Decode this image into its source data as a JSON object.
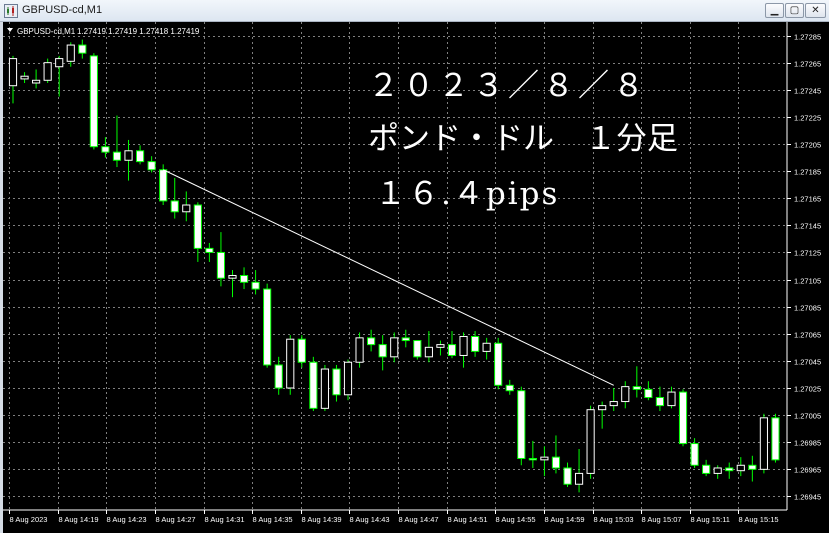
{
  "window": {
    "title": "GBPUSD-cd,M1",
    "buttons": {
      "minimize": "▁",
      "maximize": "▢",
      "close": "✕"
    }
  },
  "chart_info": {
    "symbol_label": "GBPUSD-cd,M1",
    "ohlc_label": "1.27419 1.27419 1.27418 1.27419"
  },
  "annotations": {
    "line1": "２０２３／８／８",
    "line2": "ポンド・ドル　１分足",
    "line3": "１６.４pips"
  },
  "colors": {
    "background": "#000000",
    "grid": "#7f7f7f",
    "bull_candle": "#ffffff",
    "bear_candle": "#ffffff",
    "wick": "#00ff00",
    "axis_text": "#ffffff",
    "trendline": "#ffffff"
  },
  "chart_data": {
    "type": "candlestick",
    "symbol": "GBPUSD-cd",
    "timeframe": "M1",
    "ylim": [
      1.26935,
      1.27295
    ],
    "y_ticks": [
      "1.27285",
      "1.27265",
      "1.27245",
      "1.27225",
      "1.27205",
      "1.27185",
      "1.27165",
      "1.27145",
      "1.27125",
      "1.27105",
      "1.27085",
      "1.27065",
      "1.27045",
      "1.27025",
      "1.27005",
      "1.26985",
      "1.26965",
      "1.26945"
    ],
    "x_ticks": [
      "8 Aug 2023",
      "8 Aug 14:19",
      "8 Aug 14:23",
      "8 Aug 14:27",
      "8 Aug 14:31",
      "8 Aug 14:35",
      "8 Aug 14:39",
      "8 Aug 14:43",
      "8 Aug 14:47",
      "8 Aug 14:51",
      "8 Aug 14:55",
      "8 Aug 14:59",
      "8 Aug 15:03",
      "8 Aug 15:07",
      "8 Aug 15:11",
      "8 Aug 15:15"
    ],
    "candles": [
      [
        1.27248,
        1.2727,
        1.27235,
        1.27268
      ],
      [
        1.27253,
        1.27258,
        1.2725,
        1.27255
      ],
      [
        1.2725,
        1.2726,
        1.27246,
        1.27252
      ],
      [
        1.27252,
        1.27268,
        1.2725,
        1.27265
      ],
      [
        1.27262,
        1.2727,
        1.2724,
        1.27268
      ],
      [
        1.27266,
        1.2728,
        1.27262,
        1.27278
      ],
      [
        1.27278,
        1.27282,
        1.27268,
        1.27272
      ],
      [
        1.2727,
        1.27272,
        1.27201,
        1.27203
      ],
      [
        1.27203,
        1.2721,
        1.27195,
        1.27199
      ],
      [
        1.27199,
        1.27226,
        1.27188,
        1.27193
      ],
      [
        1.27193,
        1.27208,
        1.27178,
        1.272
      ],
      [
        1.272,
        1.27204,
        1.2719,
        1.27192
      ],
      [
        1.27192,
        1.27196,
        1.27184,
        1.27186
      ],
      [
        1.27186,
        1.2719,
        1.2716,
        1.27163
      ],
      [
        1.27163,
        1.2718,
        1.2715,
        1.27155
      ],
      [
        1.27155,
        1.2717,
        1.27148,
        1.2716
      ],
      [
        1.2716,
        1.27162,
        1.27118,
        1.27128
      ],
      [
        1.27128,
        1.27132,
        1.27118,
        1.27125
      ],
      [
        1.27125,
        1.2714,
        1.271,
        1.27106
      ],
      [
        1.27106,
        1.27112,
        1.27092,
        1.27108
      ],
      [
        1.27108,
        1.27114,
        1.27098,
        1.27103
      ],
      [
        1.27103,
        1.27112,
        1.27094,
        1.27098
      ],
      [
        1.27098,
        1.27102,
        1.2704,
        1.27042
      ],
      [
        1.27042,
        1.27048,
        1.2702,
        1.27025
      ],
      [
        1.27025,
        1.27064,
        1.2702,
        1.27061
      ],
      [
        1.27061,
        1.27064,
        1.2704,
        1.27044
      ],
      [
        1.27044,
        1.27048,
        1.27008,
        1.2701
      ],
      [
        1.2701,
        1.27042,
        1.27008,
        1.27039
      ],
      [
        1.27039,
        1.27042,
        1.27015,
        1.2702
      ],
      [
        1.2702,
        1.27046,
        1.27016,
        1.27044
      ],
      [
        1.27044,
        1.27066,
        1.2704,
        1.27062
      ],
      [
        1.27062,
        1.27068,
        1.27052,
        1.27057
      ],
      [
        1.27057,
        1.27064,
        1.27038,
        1.27048
      ],
      [
        1.27048,
        1.27066,
        1.27044,
        1.27062
      ],
      [
        1.27062,
        1.27068,
        1.27055,
        1.2706
      ],
      [
        1.2706,
        1.2706,
        1.27046,
        1.27048
      ],
      [
        1.27048,
        1.27067,
        1.27044,
        1.27055
      ],
      [
        1.27055,
        1.2706,
        1.27049,
        1.27057
      ],
      [
        1.27057,
        1.27067,
        1.27047,
        1.27049
      ],
      [
        1.27049,
        1.27066,
        1.2704,
        1.27063
      ],
      [
        1.27063,
        1.27067,
        1.27048,
        1.27052
      ],
      [
        1.27052,
        1.27062,
        1.27046,
        1.27058
      ],
      [
        1.27058,
        1.27062,
        1.27024,
        1.27027
      ],
      [
        1.27027,
        1.27031,
        1.2702,
        1.27023
      ],
      [
        1.27023,
        1.27026,
        1.26968,
        1.26973
      ],
      [
        1.26973,
        1.26986,
        1.26966,
        1.26972
      ],
      [
        1.26972,
        1.26982,
        1.2696,
        1.26974
      ],
      [
        1.26974,
        1.2699,
        1.26962,
        1.26966
      ],
      [
        1.26966,
        1.2697,
        1.26952,
        1.26954
      ],
      [
        1.26954,
        1.2698,
        1.26948,
        1.26962
      ],
      [
        1.26962,
        1.27012,
        1.26958,
        1.27009
      ],
      [
        1.27009,
        1.27015,
        1.26995,
        1.27012
      ],
      [
        1.27012,
        1.27025,
        1.27008,
        1.27015
      ],
      [
        1.27015,
        1.2703,
        1.2701,
        1.27026
      ],
      [
        1.27026,
        1.27041,
        1.27018,
        1.27024
      ],
      [
        1.27024,
        1.2703,
        1.27016,
        1.27018
      ],
      [
        1.27018,
        1.27026,
        1.27008,
        1.27012
      ],
      [
        1.27012,
        1.27026,
        1.2701,
        1.27022
      ],
      [
        1.27022,
        1.27024,
        1.26982,
        1.26984
      ],
      [
        1.26984,
        1.26988,
        1.26966,
        1.26968
      ],
      [
        1.26968,
        1.26972,
        1.2696,
        1.26962
      ],
      [
        1.26962,
        1.26968,
        1.26958,
        1.26966
      ],
      [
        1.26966,
        1.2697,
        1.26958,
        1.26964
      ],
      [
        1.26964,
        1.26974,
        1.2696,
        1.26968
      ],
      [
        1.26968,
        1.26975,
        1.26956,
        1.26965
      ],
      [
        1.26965,
        1.27006,
        1.26962,
        1.27003
      ],
      [
        1.27003,
        1.27006,
        1.2697,
        1.26972
      ]
    ],
    "trendline": {
      "from": [
        13,
        1.27186
      ],
      "to": [
        52,
        1.27027
      ]
    }
  }
}
